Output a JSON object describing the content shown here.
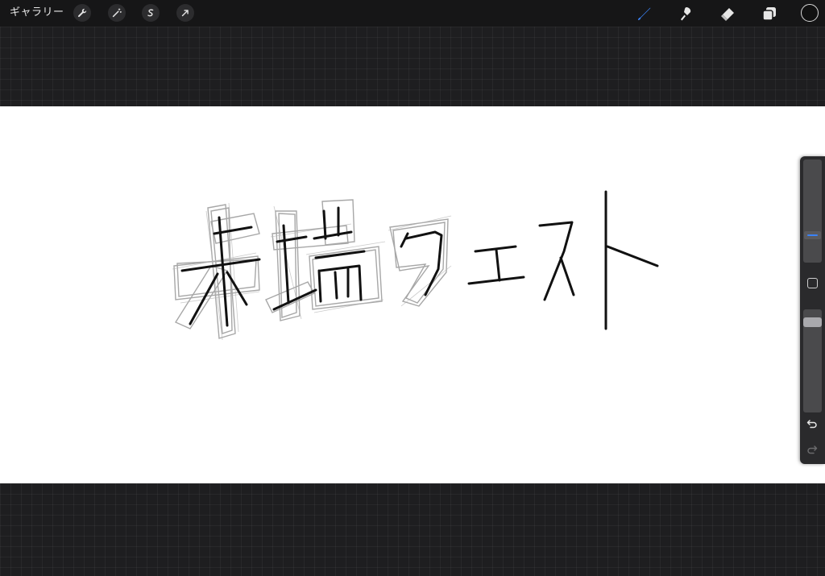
{
  "toolbar": {
    "gallery_label": "ギャラリー",
    "left_tools": [
      "wrench-icon",
      "magic-wand-icon",
      "selection-icon",
      "transform-arrow-icon"
    ],
    "right_tools": [
      "brush-icon",
      "smudge-icon",
      "eraser-icon",
      "layers-icon"
    ],
    "active_tool": "brush",
    "accent_color": "#3a82f7",
    "current_color": "#111111"
  },
  "canvas": {
    "background": "#ffffff",
    "drawing": "末端クエスト"
  },
  "sidebar": {
    "size_slider_level": 0.25,
    "opacity_slider_level": 0.95,
    "undo_icon": "undo-icon",
    "redo_icon": "redo-icon"
  }
}
